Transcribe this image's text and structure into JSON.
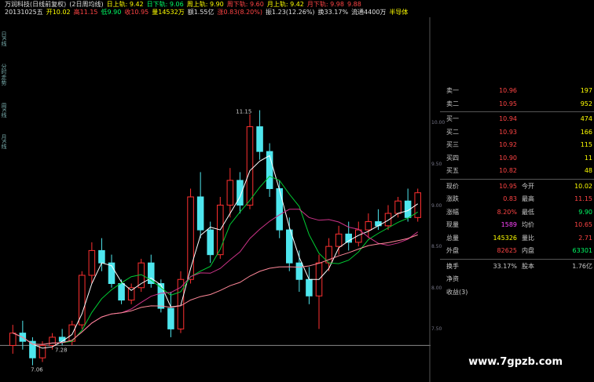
{
  "header": {
    "row1": [
      {
        "text": "万润科技(日线前复权)",
        "color": "#e0e0e0"
      },
      {
        "text": "(2日周均线)",
        "color": "#e0e0e0"
      },
      {
        "text": "日上轨: 9.42",
        "color": "#ffff00"
      },
      {
        "text": "日下轨: 9.06",
        "color": "#00ff66"
      },
      {
        "text": "周上轨: 9.90",
        "color": "#ffff00"
      },
      {
        "text": "周下轨: 9.60",
        "color": "#ff4444"
      },
      {
        "text": "月上轨: 9.42",
        "color": "#ffff00"
      },
      {
        "text": "月下轨: 9.98",
        "color": "#ff4444"
      },
      {
        "text": "9.88",
        "color": "#ff4444"
      }
    ],
    "row2": [
      {
        "text": "20131025五",
        "color": "#e0e0e0"
      },
      {
        "text": "开10.02",
        "color": "#ffff00"
      },
      {
        "text": "高11.15",
        "color": "#ff4444"
      },
      {
        "text": "低9.90",
        "color": "#00ff66"
      },
      {
        "text": "收10.95",
        "color": "#ff4444"
      },
      {
        "text": "量14532万",
        "color": "#ffff00"
      },
      {
        "text": "额1.55亿",
        "color": "#e0e0e0"
      },
      {
        "text": "涨0.83(8.20%)",
        "color": "#ff4444"
      },
      {
        "text": "振1.23(12.26%)",
        "color": "#e0e0e0"
      },
      {
        "text": "换33.17%",
        "color": "#e0e0e0"
      },
      {
        "text": "流通4400万",
        "color": "#e0e0e0"
      },
      {
        "text": "半导体",
        "color": "#ffff00"
      }
    ]
  },
  "sidebar": {
    "tabs": [
      "日K线",
      "分时走势",
      "周K线",
      "月K线"
    ]
  },
  "price_axis": [
    {
      "text": "10.00",
      "price": 10.0
    },
    {
      "text": "9.50",
      "price": 9.5
    },
    {
      "text": "9.00",
      "price": 9.0
    },
    {
      "text": "8.50",
      "price": 8.5
    },
    {
      "text": "8.00",
      "price": 8.0
    },
    {
      "text": "7.50",
      "price": 7.5
    }
  ],
  "chart_marks": {
    "high_label": "11.15",
    "low_label": "7.28",
    "low_label2": "7.06"
  },
  "order_book": {
    "asks": [
      {
        "label": "卖一",
        "price": "10.96",
        "vol": "197"
      },
      {
        "label": "卖二",
        "price": "10.95",
        "vol": "952"
      }
    ],
    "bids": [
      {
        "label": "买一",
        "price": "10.94",
        "vol": "474"
      },
      {
        "label": "买二",
        "price": "10.93",
        "vol": "166"
      },
      {
        "label": "买三",
        "price": "10.92",
        "vol": "115"
      },
      {
        "label": "买四",
        "price": "10.90",
        "vol": "11"
      },
      {
        "label": "买五",
        "price": "10.82",
        "vol": "48"
      }
    ]
  },
  "quote": [
    {
      "l1": "现价",
      "v1": "10.95",
      "l2": "今开",
      "v2": "10.02",
      "c1": "#ff4444",
      "c2": "#ffff00"
    },
    {
      "l1": "涨跌",
      "v1": "0.83",
      "l2": "最高",
      "v2": "11.15",
      "c1": "#ff4444",
      "c2": "#ff4444"
    },
    {
      "l1": "涨幅",
      "v1": "8.20%",
      "l2": "最低",
      "v2": "9.90",
      "c1": "#ff4444",
      "c2": "#00ff66"
    },
    {
      "l1": "现量",
      "v1": "1589",
      "l2": "均价",
      "v2": "10.65",
      "c1": "#ff44ff",
      "c2": "#ff4444"
    },
    {
      "l1": "总量",
      "v1": "145326",
      "l2": "量比",
      "v2": "2.71",
      "c1": "#ffff00",
      "c2": "#ff4444"
    },
    {
      "l1": "外盘",
      "v1": "82625",
      "l2": "内盘",
      "v2": "63301",
      "c1": "#ff4444",
      "c2": "#00ff66"
    }
  ],
  "extra": [
    {
      "l1": "换手",
      "v1": "33.17%",
      "l2": "股本",
      "v2": "1.76亿"
    },
    {
      "l1": "净资",
      "v1": "",
      "l2": "",
      "v2": ""
    },
    {
      "l1": "收益(3)",
      "v1": "",
      "l2": "",
      "v2": ""
    }
  ],
  "watermark": "www.7gpzb.com",
  "colors": {
    "up": "#ff3030",
    "down": "#4ee6ee",
    "ma1": "#ffffff",
    "ma2": "#cc3388",
    "ma3": "#ff8899",
    "ma4": "#00cc33"
  },
  "chart_data": {
    "type": "candlestick",
    "ylim": [
      7.0,
      11.2
    ],
    "candles": [
      {
        "o": 7.3,
        "h": 7.55,
        "l": 7.2,
        "c": 7.45
      },
      {
        "o": 7.45,
        "h": 7.6,
        "l": 7.25,
        "c": 7.35
      },
      {
        "o": 7.35,
        "h": 7.4,
        "l": 7.06,
        "c": 7.15
      },
      {
        "o": 7.15,
        "h": 7.35,
        "l": 7.1,
        "c": 7.3
      },
      {
        "o": 7.3,
        "h": 7.45,
        "l": 7.25,
        "c": 7.4
      },
      {
        "o": 7.4,
        "h": 7.5,
        "l": 7.3,
        "c": 7.35
      },
      {
        "o": 7.35,
        "h": 7.6,
        "l": 7.3,
        "c": 7.55
      },
      {
        "o": 7.55,
        "h": 8.2,
        "l": 7.5,
        "c": 8.15
      },
      {
        "o": 8.15,
        "h": 8.55,
        "l": 8.05,
        "c": 8.45
      },
      {
        "o": 8.45,
        "h": 8.6,
        "l": 8.2,
        "c": 8.3
      },
      {
        "o": 8.3,
        "h": 8.4,
        "l": 8.0,
        "c": 8.05
      },
      {
        "o": 8.05,
        "h": 8.1,
        "l": 7.8,
        "c": 7.85
      },
      {
        "o": 7.85,
        "h": 8.05,
        "l": 7.8,
        "c": 8.0
      },
      {
        "o": 8.0,
        "h": 8.35,
        "l": 7.95,
        "c": 8.3
      },
      {
        "o": 8.3,
        "h": 8.4,
        "l": 8.0,
        "c": 8.05
      },
      {
        "o": 8.05,
        "h": 8.1,
        "l": 7.7,
        "c": 7.75
      },
      {
        "o": 7.75,
        "h": 7.95,
        "l": 7.4,
        "c": 7.5
      },
      {
        "o": 7.5,
        "h": 8.2,
        "l": 7.45,
        "c": 8.1
      },
      {
        "o": 8.1,
        "h": 9.2,
        "l": 8.05,
        "c": 9.1
      },
      {
        "o": 9.1,
        "h": 9.4,
        "l": 8.6,
        "c": 8.7
      },
      {
        "o": 8.7,
        "h": 8.8,
        "l": 8.3,
        "c": 8.4
      },
      {
        "o": 8.4,
        "h": 9.1,
        "l": 8.35,
        "c": 9.0
      },
      {
        "o": 9.0,
        "h": 9.45,
        "l": 8.85,
        "c": 9.3
      },
      {
        "o": 9.3,
        "h": 9.4,
        "l": 8.9,
        "c": 9.0
      },
      {
        "o": 9.0,
        "h": 10.1,
        "l": 8.95,
        "c": 9.95
      },
      {
        "o": 9.95,
        "h": 10.15,
        "l": 9.55,
        "c": 9.65
      },
      {
        "o": 9.65,
        "h": 9.75,
        "l": 9.1,
        "c": 9.2
      },
      {
        "o": 9.2,
        "h": 9.3,
        "l": 8.6,
        "c": 8.7
      },
      {
        "o": 8.7,
        "h": 8.85,
        "l": 8.2,
        "c": 8.3
      },
      {
        "o": 8.3,
        "h": 8.45,
        "l": 7.95,
        "c": 8.1
      },
      {
        "o": 8.1,
        "h": 8.25,
        "l": 7.8,
        "c": 7.9
      },
      {
        "o": 7.9,
        "h": 8.4,
        "l": 7.5,
        "c": 8.3
      },
      {
        "o": 8.3,
        "h": 8.6,
        "l": 8.2,
        "c": 8.5
      },
      {
        "o": 8.5,
        "h": 8.75,
        "l": 8.4,
        "c": 8.65
      },
      {
        "o": 8.65,
        "h": 8.8,
        "l": 8.45,
        "c": 8.55
      },
      {
        "o": 8.55,
        "h": 8.8,
        "l": 8.5,
        "c": 8.7
      },
      {
        "o": 8.7,
        "h": 8.9,
        "l": 8.6,
        "c": 8.8
      },
      {
        "o": 8.8,
        "h": 8.95,
        "l": 8.7,
        "c": 8.75
      },
      {
        "o": 8.75,
        "h": 9.0,
        "l": 8.7,
        "c": 8.9
      },
      {
        "o": 8.9,
        "h": 9.1,
        "l": 8.85,
        "c": 9.05
      },
      {
        "o": 9.05,
        "h": 9.2,
        "l": 8.8,
        "c": 8.85
      },
      {
        "o": 8.85,
        "h": 9.2,
        "l": 8.8,
        "c": 9.15
      }
    ]
  }
}
